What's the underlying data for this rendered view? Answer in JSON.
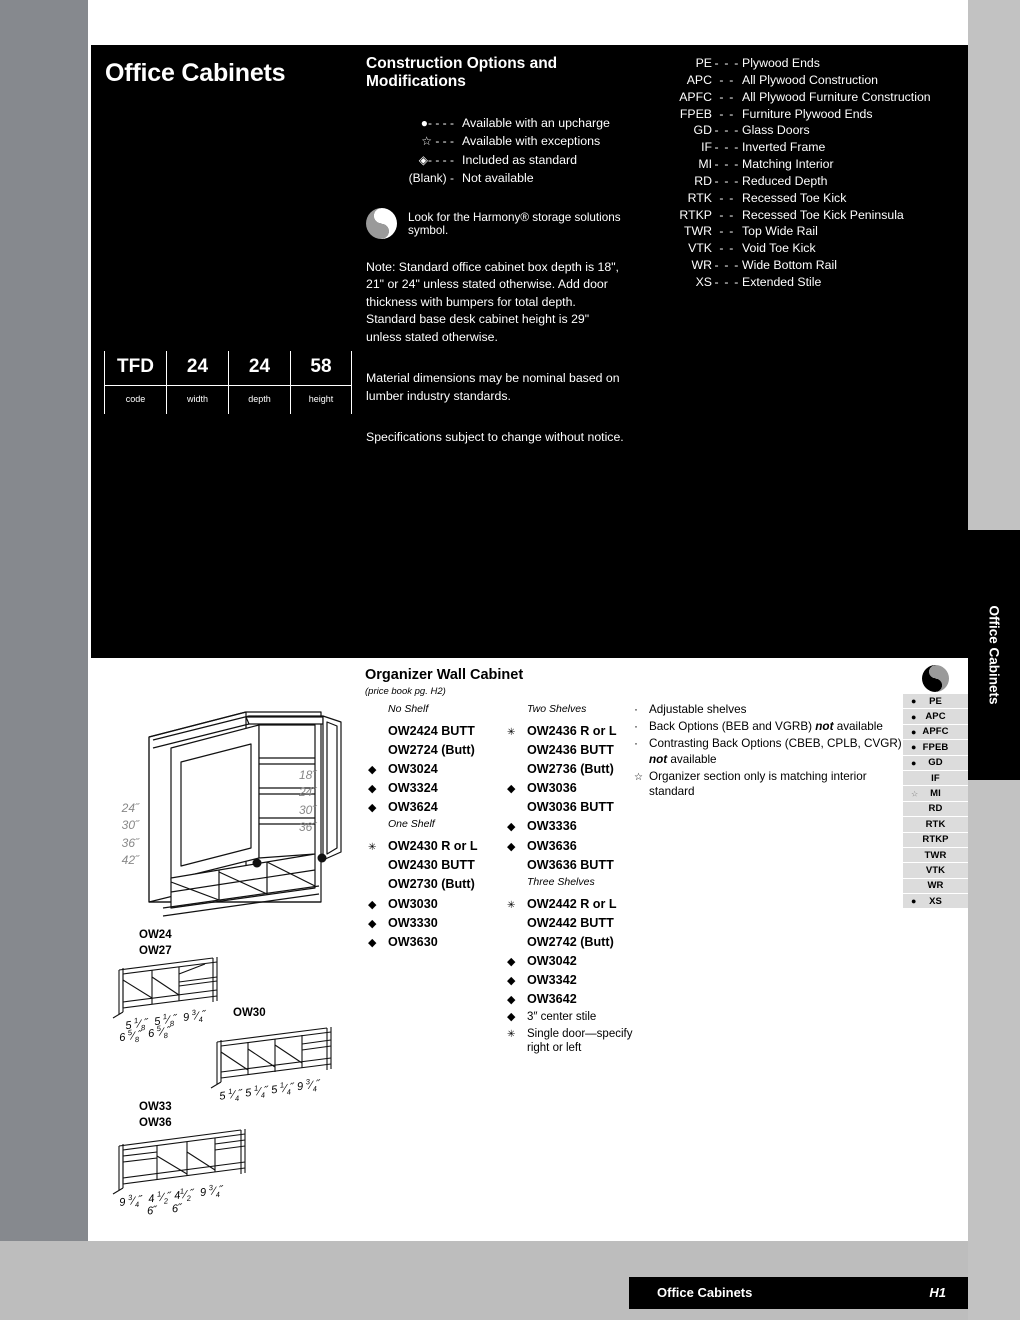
{
  "page": {
    "title": "Office Cabinets",
    "side_tab": "Office Cabinets",
    "footer_title": "Office Cabinets",
    "footer_page": "H1"
  },
  "construction": {
    "heading": "Construction Options and Modifications",
    "legend": [
      {
        "mark": "●- - - -",
        "text": "Available with an upcharge"
      },
      {
        "mark": "☆  - - -",
        "text": "Available with exceptions"
      },
      {
        "mark": "◈- - - -",
        "text": "Included as standard"
      },
      {
        "mark": "(Blank)  -",
        "text": "Not available"
      }
    ],
    "harmony_text": "Look for the Harmony® storage solutions symbol.",
    "notes": [
      "Note: Standard office cabinet box depth is 18\", 21\" or 24\" unless stated otherwise. Add door thickness with bumpers for total depth. Standard base desk cabinet height is 29\" unless stated otherwise.",
      "Material dimensions may be nominal based on lumber industry standards.",
      "Specifications subject to change without notice."
    ]
  },
  "glossary": [
    {
      "abbr": "PE",
      "dash": "- - -",
      "def": "Plywood Ends"
    },
    {
      "abbr": "APC",
      "dash": "- -",
      "def": "All Plywood Construction"
    },
    {
      "abbr": "APFC",
      "dash": "- -",
      "def": "All Plywood Furniture Construction"
    },
    {
      "abbr": "FPEB",
      "dash": "- -",
      "def": "Furniture Plywood Ends"
    },
    {
      "abbr": "GD",
      "dash": "- - -",
      "def": "Glass Doors"
    },
    {
      "abbr": "IF",
      "dash": "- - -",
      "def": "Inverted Frame"
    },
    {
      "abbr": "MI",
      "dash": "- - -",
      "def": "Matching Interior"
    },
    {
      "abbr": "RD",
      "dash": "- - -",
      "def": "Reduced Depth"
    },
    {
      "abbr": "RTK",
      "dash": "- -",
      "def": "Recessed Toe Kick"
    },
    {
      "abbr": "RTKP",
      "dash": "- -",
      "def": "Recessed Toe Kick Peninsula"
    },
    {
      "abbr": "TWR",
      "dash": "- -",
      "def": "Top Wide Rail"
    },
    {
      "abbr": "VTK",
      "dash": "- -",
      "def": "Void Toe Kick"
    },
    {
      "abbr": "WR",
      "dash": "- - -",
      "def": "Wide Bottom Rail"
    },
    {
      "abbr": "XS",
      "dash": "- - -",
      "def": "Extended Stile"
    }
  ],
  "code_key": {
    "values": [
      "TFD",
      "24",
      "24",
      "58"
    ],
    "labels": [
      "code",
      "width",
      "depth",
      "height"
    ]
  },
  "product": {
    "title": "Organizer Wall Cabinet",
    "subtitle": "(price book pg. H2)",
    "column1": [
      {
        "type": "subhead",
        "text": "No Shelf"
      },
      {
        "type": "code",
        "mark": "",
        "text": "OW2424 BUTT"
      },
      {
        "type": "code",
        "mark": "",
        "text": "OW2724 (Butt)"
      },
      {
        "type": "code",
        "mark": "◆",
        "text": "OW3024"
      },
      {
        "type": "code",
        "mark": "◆",
        "text": "OW3324"
      },
      {
        "type": "code",
        "mark": "◆",
        "text": "OW3624"
      },
      {
        "type": "subhead",
        "text": "One Shelf"
      },
      {
        "type": "code",
        "mark": "✳",
        "text": "OW2430 R or L"
      },
      {
        "type": "code",
        "mark": "",
        "text": "OW2430 BUTT"
      },
      {
        "type": "code",
        "mark": "",
        "text": "OW2730 (Butt)"
      },
      {
        "type": "code",
        "mark": "◆",
        "text": "OW3030"
      },
      {
        "type": "code",
        "mark": "◆",
        "text": "OW3330"
      },
      {
        "type": "code",
        "mark": "◆",
        "text": "OW3630"
      }
    ],
    "column2": [
      {
        "type": "subhead",
        "text": "Two Shelves"
      },
      {
        "type": "code",
        "mark": "✳",
        "text": "OW2436 R or L"
      },
      {
        "type": "code",
        "mark": "",
        "text": "OW2436 BUTT"
      },
      {
        "type": "code",
        "mark": "",
        "text": "OW2736 (Butt)"
      },
      {
        "type": "code",
        "mark": "◆",
        "text": "OW3036"
      },
      {
        "type": "code",
        "mark": "",
        "text": "OW3036 BUTT"
      },
      {
        "type": "code",
        "mark": "◆",
        "text": "OW3336"
      },
      {
        "type": "code",
        "mark": "◆",
        "text": "OW3636"
      },
      {
        "type": "code",
        "mark": "",
        "text": "OW3636 BUTT"
      },
      {
        "type": "subhead",
        "text": "Three Shelves"
      },
      {
        "type": "code",
        "mark": "✳",
        "text": "OW2442 R or L"
      },
      {
        "type": "code",
        "mark": "",
        "text": "OW2442 BUTT"
      },
      {
        "type": "code",
        "mark": "",
        "text": "OW2742 (Butt)"
      },
      {
        "type": "code",
        "mark": "◆",
        "text": "OW3042"
      },
      {
        "type": "code",
        "mark": "◆",
        "text": "OW3342"
      },
      {
        "type": "code",
        "mark": "◆",
        "text": "OW3642"
      },
      {
        "type": "note",
        "mark": "◆",
        "text": "3″ center stile"
      },
      {
        "type": "note2",
        "mark": "✳",
        "text": "Single door—specify right or left"
      }
    ],
    "features": [
      {
        "mark": "·",
        "text": "Adjustable shelves",
        "html": "Adjustable shelves"
      },
      {
        "mark": "·",
        "text": "Back Options (BEB and VGRB) not available",
        "html": "Back Options (BEB and VGRB) <b>not</b> available"
      },
      {
        "mark": "·",
        "text": "Contrasting Back Options (CBEB, CPLB, CVGR) not available",
        "html": "Contrasting Back Options (CBEB, CPLB, CVGR) <b>not</b> available"
      },
      {
        "mark": "☆",
        "text": "Organizer section only is matching interior standard",
        "html": "Organizer section only is matching interior standard"
      }
    ]
  },
  "spec_sidebar": [
    {
      "label": "PE",
      "mark": "●"
    },
    {
      "label": "APC",
      "mark": "●"
    },
    {
      "label": "APFC",
      "mark": "●"
    },
    {
      "label": "FPEB",
      "mark": "●"
    },
    {
      "label": "GD",
      "mark": "●"
    },
    {
      "label": "IF",
      "mark": ""
    },
    {
      "label": "MI",
      "mark": "☆"
    },
    {
      "label": "RD",
      "mark": ""
    },
    {
      "label": "RTK",
      "mark": ""
    },
    {
      "label": "RTKP",
      "mark": ""
    },
    {
      "label": "TWR",
      "mark": ""
    },
    {
      "label": "VTK",
      "mark": ""
    },
    {
      "label": "WR",
      "mark": ""
    },
    {
      "label": "XS",
      "mark": "●"
    }
  ],
  "illustrations": {
    "main": {
      "left_dims": "24˝\n30˝\n36˝\n42˝",
      "right_dims": "18˝\n24˝\n30˝\n36˝",
      "labels": "OW24\nOW27"
    },
    "ow27": {
      "labels": "OW24\nOW27",
      "top_dims": [
        "5 1/8˝",
        "5 1/8˝",
        "9 3/4˝"
      ],
      "bottom_dims": [
        "6 5/8˝",
        "6 5/8˝"
      ]
    },
    "ow30": {
      "label": "OW30",
      "dims": [
        "5 1/4˝",
        "5 1/4˝",
        "5 1/4˝",
        "9 3/4˝"
      ]
    },
    "ow33": {
      "labels": "OW33\nOW36",
      "top_dims": [
        "9 3/4˝",
        "4 1/2˝",
        "4 1/2˝",
        "9 3/4˝"
      ],
      "bottom_dims": [
        "6˝",
        "6˝"
      ]
    }
  }
}
